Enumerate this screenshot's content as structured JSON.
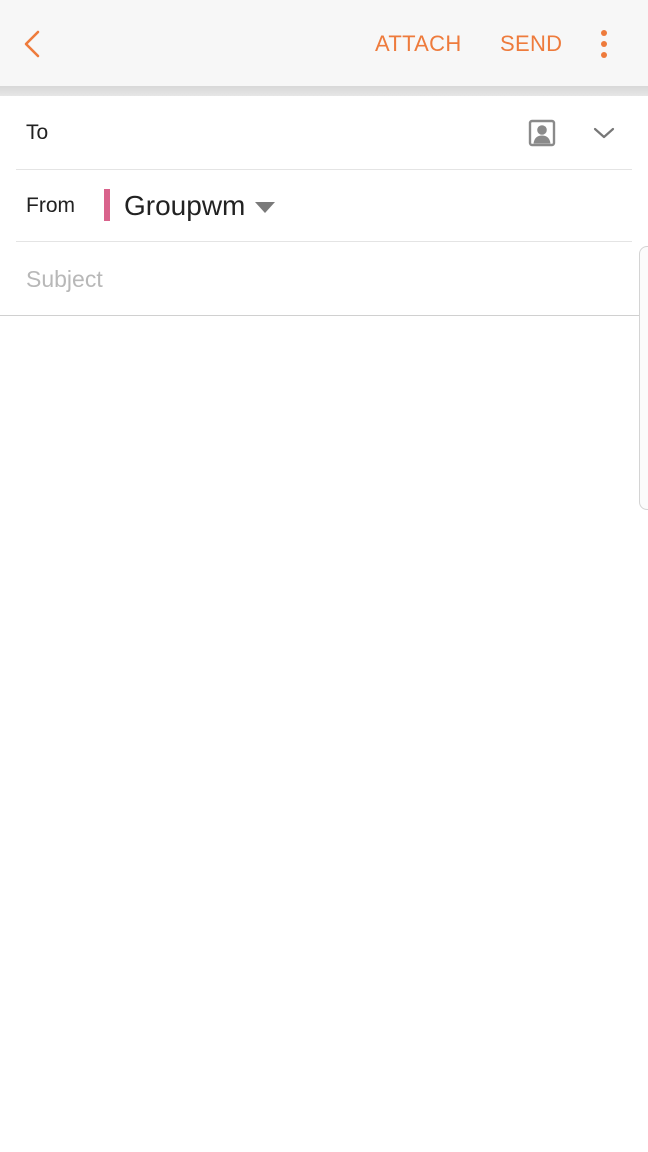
{
  "toolbar": {
    "back_icon": "chevron-left-icon",
    "attach_label": "ATTACH",
    "send_label": "SEND",
    "more_icon": "more-vertical-icon"
  },
  "colors": {
    "accent": "#ee7b3c",
    "account_marker": "#d9638c",
    "placeholder": "#b8b8b8"
  },
  "compose": {
    "to_label": "To",
    "to_value": "",
    "contacts_icon": "contact-book-icon",
    "expand_icon": "chevron-down-icon",
    "from_label": "From",
    "from_account": "Groupwm",
    "from_dropdown_icon": "triangle-down-icon",
    "subject_placeholder": "Subject",
    "subject_value": "",
    "body_value": ""
  }
}
